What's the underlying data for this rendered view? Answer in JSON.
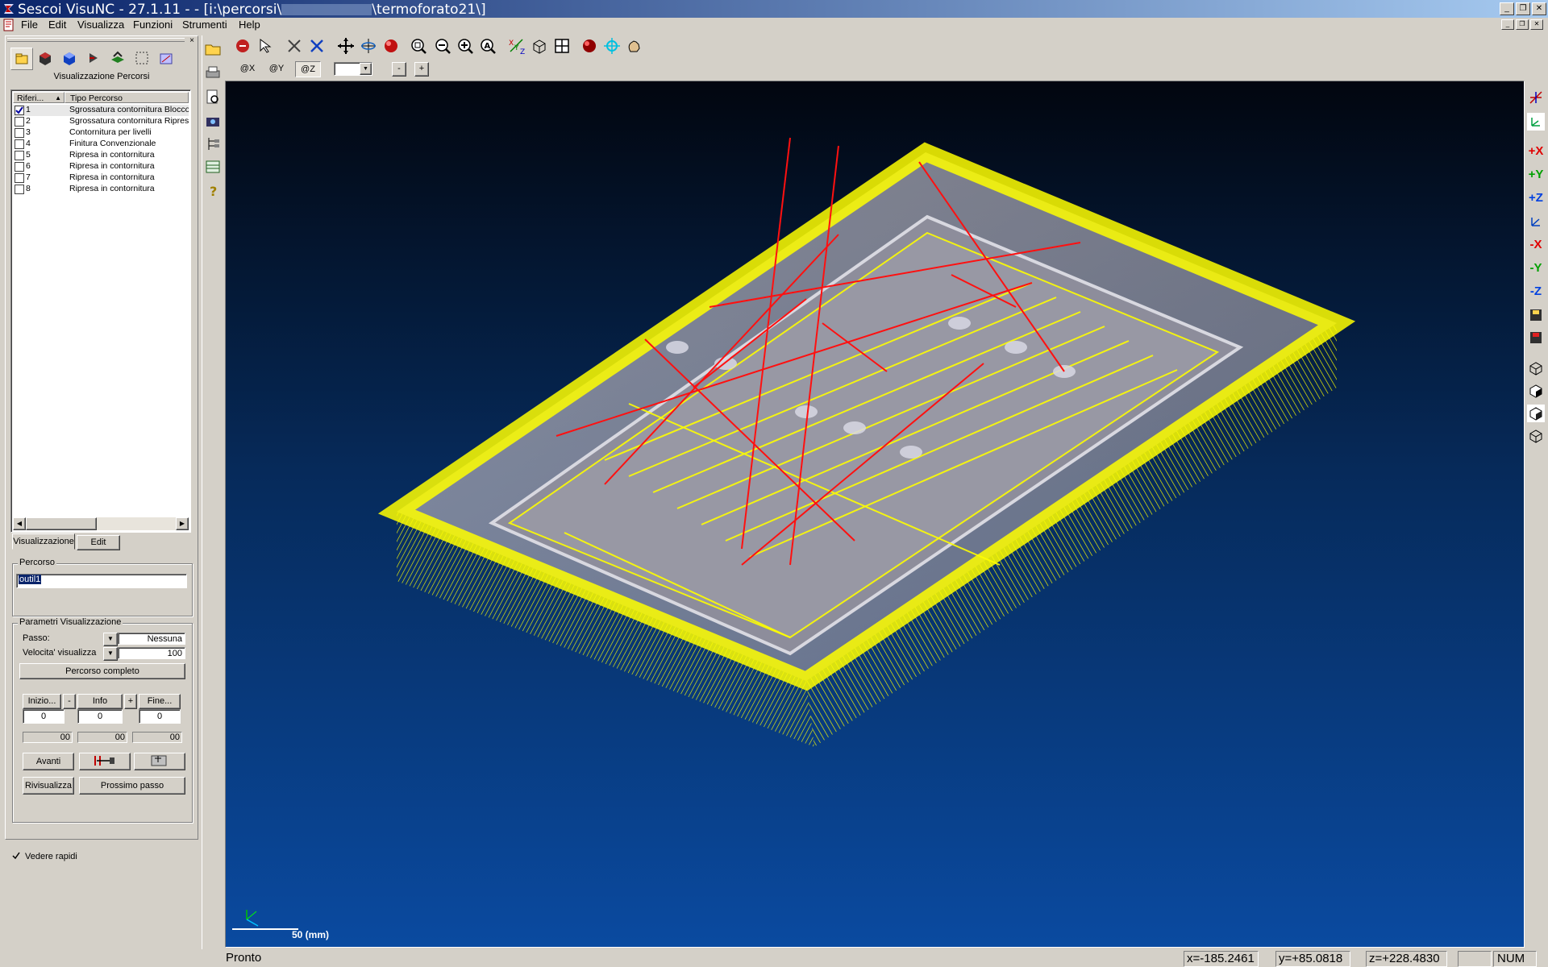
{
  "window": {
    "title": "Sescoi VisuNC - 27.1.11 - - [i:\\percorsi\\",
    "title_suffix": "\\termoforato21\\]"
  },
  "menu": [
    "File",
    "Edit",
    "Visualizza",
    "Funzioni",
    "Strumenti",
    "Help"
  ],
  "view_tabs": {
    "x": "@X",
    "y": "@Y",
    "z": "@Z",
    "minus": "-",
    "plus": "+"
  },
  "panel": {
    "title": "Visualizzazione Percorsi",
    "columns": {
      "ref": "Riferi...",
      "type": "Tipo Percorso"
    },
    "rows": [
      {
        "ref": "1",
        "type": "Sgrossatura contornitura Blocco",
        "checked": true
      },
      {
        "ref": "2",
        "type": "Sgrossatura contornitura Ripresa",
        "checked": false
      },
      {
        "ref": "3",
        "type": "Contornitura per livelli",
        "checked": false
      },
      {
        "ref": "4",
        "type": "Finitura Convenzionale",
        "checked": false
      },
      {
        "ref": "5",
        "type": "Ripresa in contornitura",
        "checked": false
      },
      {
        "ref": "6",
        "type": "Ripresa in contornitura",
        "checked": false
      },
      {
        "ref": "7",
        "type": "Ripresa in contornitura",
        "checked": false
      },
      {
        "ref": "8",
        "type": "Ripresa in contornitura",
        "checked": false
      }
    ],
    "tabs": {
      "view": "Visualizzazione",
      "edit": "Edit"
    },
    "percorso": {
      "label": "Percorso",
      "value": "outil1"
    },
    "params": {
      "label": "Parametri Visualizzazione",
      "passo_label": "Passo:",
      "passo_value": "Nessuna",
      "speed_label": "Velocita' visualizza",
      "speed_value": "100",
      "full_path": "Percorso completo"
    },
    "nav": {
      "start": "Inizio...",
      "minus": "-",
      "info": "Info",
      "plus": "+",
      "end": "Fine..."
    },
    "counters": [
      "0",
      "0",
      "0"
    ],
    "times": [
      "00",
      "00",
      "00"
    ],
    "avanti": "Avanti",
    "rivisualizza": "Rivisualizza",
    "prossimo": "Prossimo passo",
    "vedere_rapidi": "Vedere rapidi"
  },
  "right_toolbar": {
    "px": "+X",
    "py": "+Y",
    "pz": "+Z",
    "mx": "-X",
    "my": "-Y",
    "mz": "-Z"
  },
  "scale": "50 (mm)",
  "status": {
    "ready": "Pronto",
    "x": "x=-185.2461",
    "y": "y=+85.0818",
    "z": "z=+228.4830",
    "num": "NUM"
  },
  "colors": {
    "toolpath": "#ffff00",
    "rapid": "#ff0000",
    "part": "#9a9aa6"
  }
}
